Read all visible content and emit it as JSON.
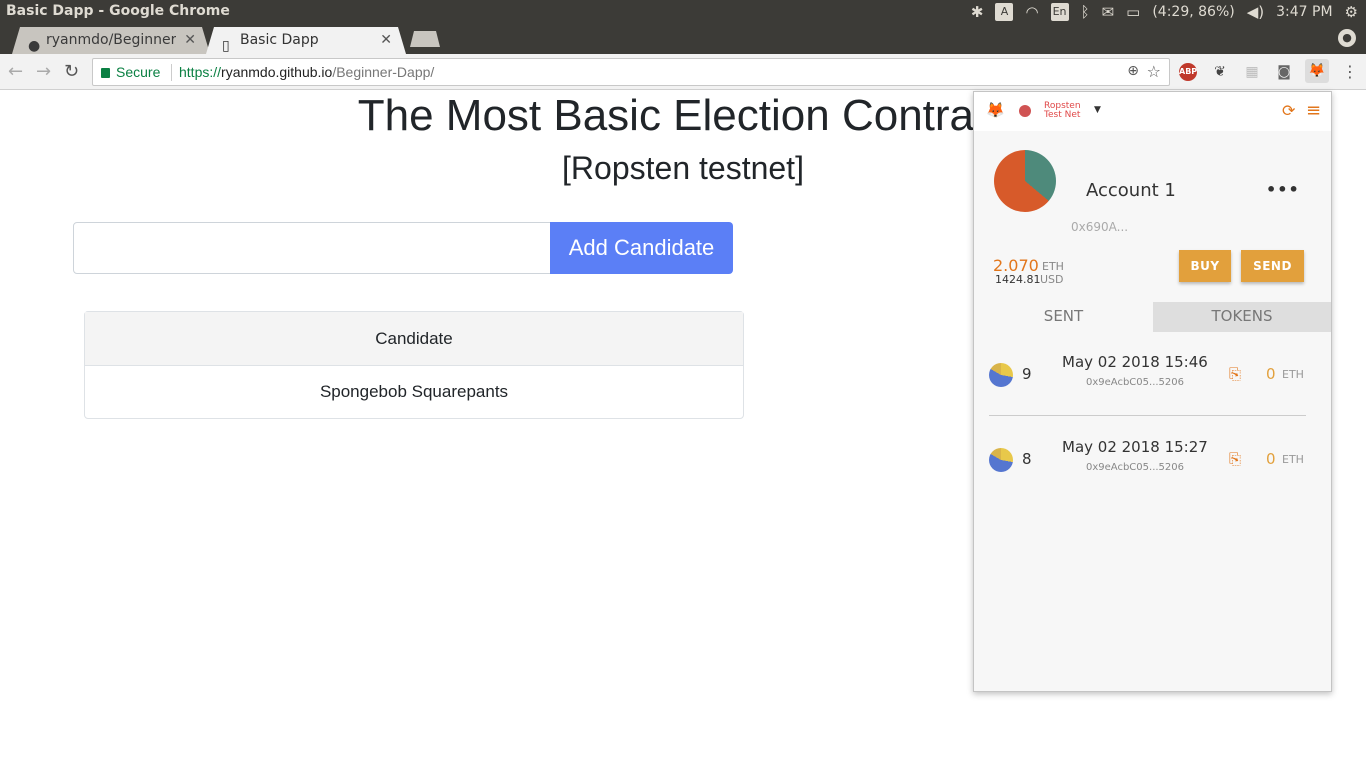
{
  "os": {
    "window_title": "Basic Dapp - Google Chrome",
    "keyboard": "En",
    "battery": "(4:29, 86%)",
    "clock": "3:47 PM"
  },
  "browser": {
    "tabs": [
      {
        "label": "ryanmdo/Beginner-Dapp",
        "icon": "github-icon"
      },
      {
        "label": "Basic Dapp",
        "icon": "page-icon"
      }
    ],
    "secure_label": "Secure",
    "url_scheme": "https://",
    "url_host": "ryanmdo.github.io",
    "url_path": "/Beginner-Dapp/",
    "extensions": {
      "abp": "ABP"
    }
  },
  "page": {
    "title": "The Most Basic Election Contract",
    "subtitle": "[Ropsten testnet]",
    "input_value": "",
    "add_button": "Add Candidate",
    "table_header": "Candidate",
    "candidates": [
      "Spongebob Squarepants"
    ]
  },
  "metamask": {
    "network_line1": "Ropsten",
    "network_line2": "Test Net",
    "account_name": "Account 1",
    "address": "0x690A...",
    "balance_eth": "2.070",
    "eth_unit": "ETH",
    "balance_usd": "1424.81",
    "usd_unit": "USD",
    "buy": "BUY",
    "send": "SEND",
    "tabs": {
      "sent": "SENT",
      "tokens": "TOKENS"
    },
    "transactions": [
      {
        "nonce": "9",
        "date": "May 02 2018 15:46",
        "hash": "0x9eAcbC05...5206",
        "amount": "0",
        "unit": "ETH"
      },
      {
        "nonce": "8",
        "date": "May 02 2018 15:27",
        "hash": "0x9eAcbC05...5206",
        "amount": "0",
        "unit": "ETH"
      }
    ],
    "colors": {
      "accent": "#e2761b",
      "button": "#e2a03c"
    }
  }
}
